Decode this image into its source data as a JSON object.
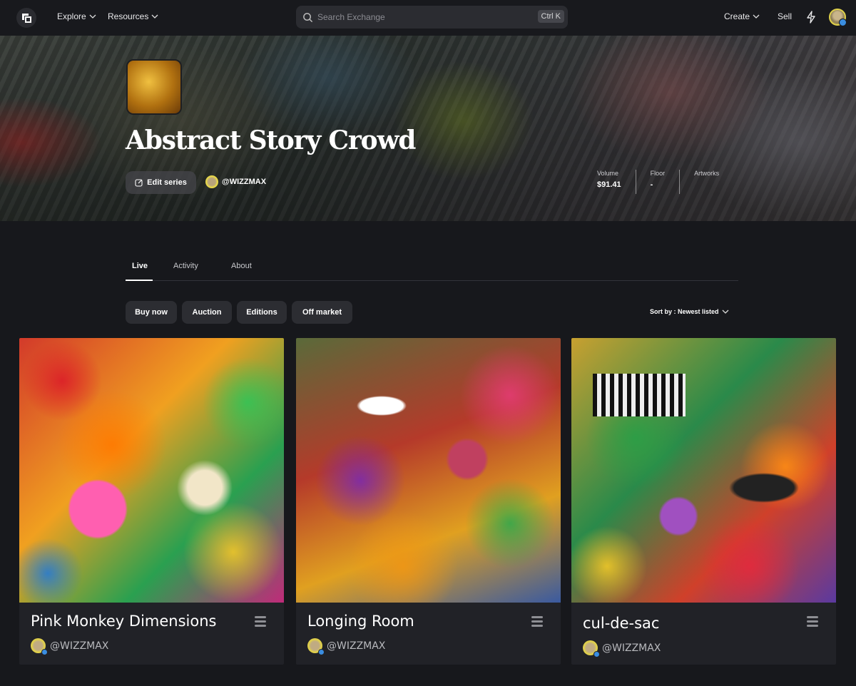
{
  "nav": {
    "explore": "Explore",
    "resources": "Resources",
    "search_placeholder": "Search Exchange",
    "search_shortcut": "Ctrl K",
    "create": "Create",
    "sell": "Sell"
  },
  "series": {
    "title": "Abstract Story Crowd",
    "edit_label": "Edit series",
    "creator": "@WIZZMAX",
    "stats": [
      {
        "label": "Volume",
        "value": "$91.41"
      },
      {
        "label": "Floor",
        "value": "-"
      },
      {
        "label": "Artworks",
        "value": ""
      }
    ]
  },
  "tabs": [
    "Live",
    "Activity",
    "About"
  ],
  "filters": [
    "Buy now",
    "Auction",
    "Editions",
    "Off market"
  ],
  "sort_label": "Sort by : Newest listed",
  "cards": [
    {
      "title": "Pink Monkey Dimensions",
      "author": "@WIZZMAX"
    },
    {
      "title": "Longing Room",
      "author": "@WIZZMAX"
    },
    {
      "title": "cul-de-sac",
      "author": "@WIZZMAX"
    }
  ],
  "colors": {
    "background": "#17181c",
    "card": "#212227",
    "chip": "#2c2d32",
    "verified": "#3a8de0"
  }
}
